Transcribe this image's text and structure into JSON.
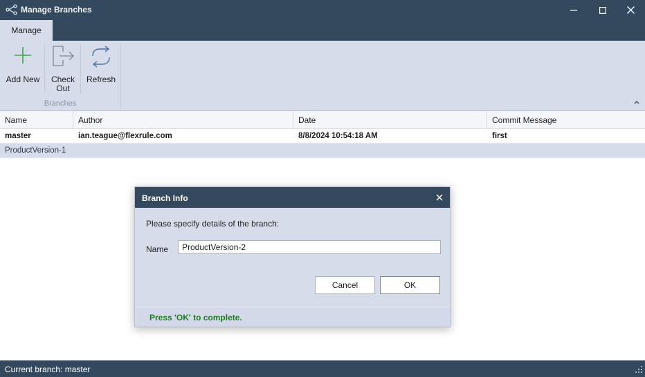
{
  "window": {
    "title": "Manage Branches"
  },
  "ribbon": {
    "tab": "Manage",
    "buttons": {
      "add_new": "Add New",
      "check_out_line1": "Check",
      "check_out_line2": "Out",
      "refresh": "Refresh"
    },
    "group_label": "Branches"
  },
  "grid": {
    "columns": [
      "Name",
      "Author",
      "Date",
      "Commit Message"
    ],
    "rows": [
      {
        "name": "master",
        "author": "ian.teague@flexrule.com",
        "date": "8/8/2024 10:54:18 AM",
        "message": "first"
      },
      {
        "name": "ProductVersion-1",
        "author": "",
        "date": "",
        "message": ""
      }
    ]
  },
  "status": {
    "text": "Current branch: master"
  },
  "dialog": {
    "title": "Branch Info",
    "prompt": "Please specify details of the branch:",
    "name_label": "Name",
    "name_value": "ProductVersion-2",
    "cancel_label": "Cancel",
    "ok_label": "OK",
    "footer_message": "Press 'OK' to complete."
  },
  "colors": {
    "titlebar": "#34495e",
    "ribbon": "#d6dcea",
    "success_text": "#1f7a1f",
    "add_icon": "#3aa64a",
    "icon_stroke": "#4a6fa5"
  },
  "icons": {
    "app": "branch-icon",
    "add_new": "plus-icon",
    "check_out": "checkout-icon",
    "refresh": "refresh-icon"
  }
}
